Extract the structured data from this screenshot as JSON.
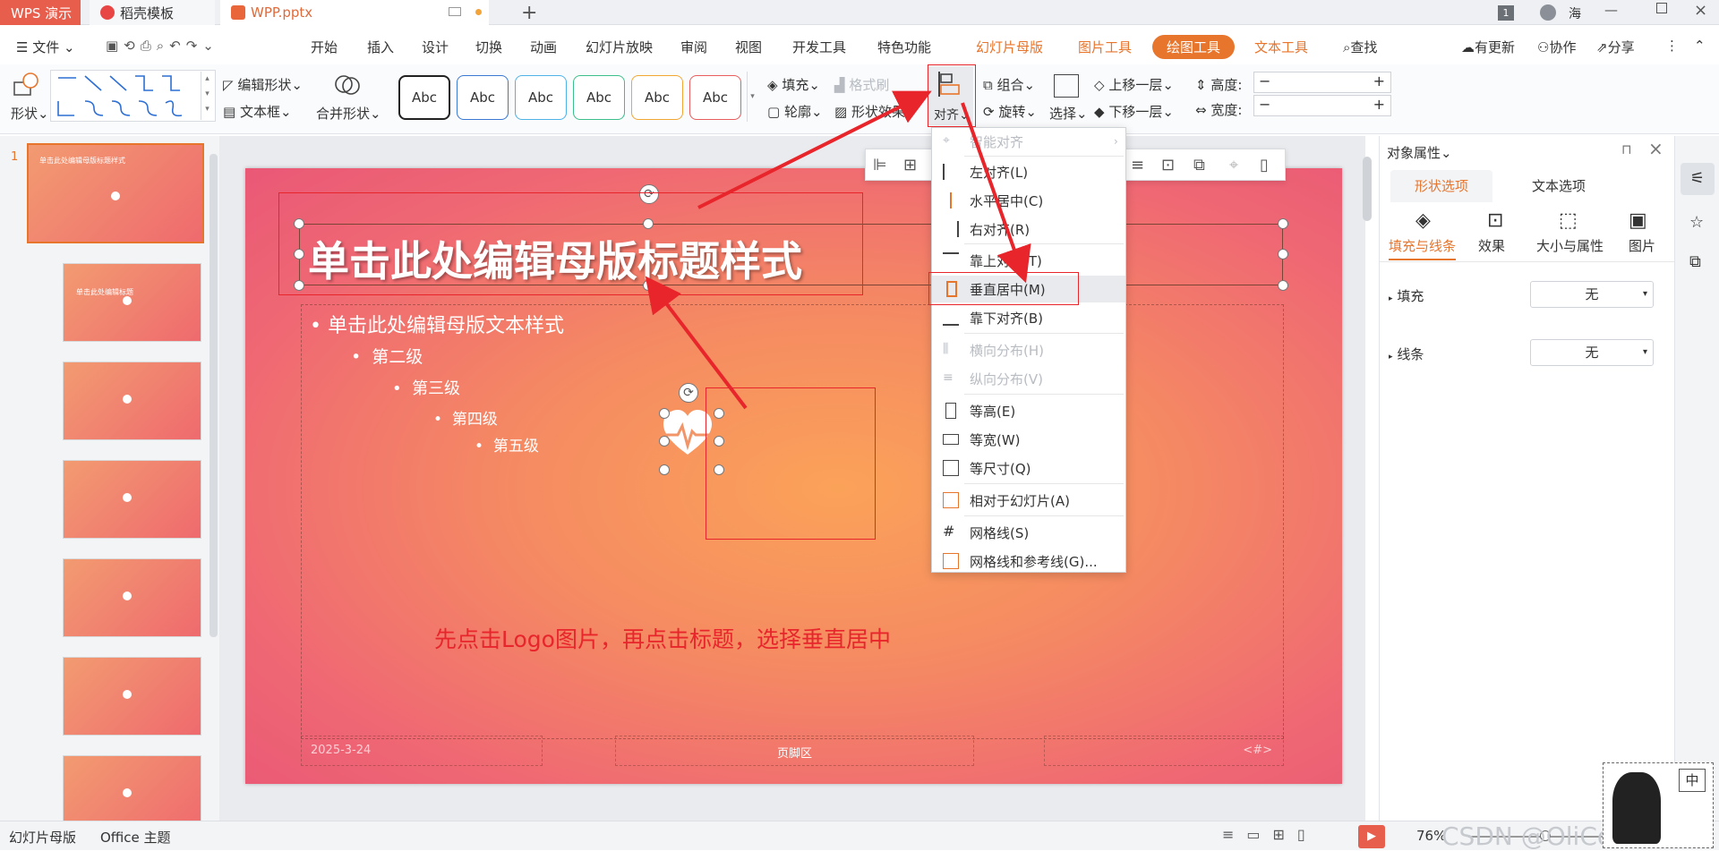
{
  "tabs": {
    "app": "WPS 演示",
    "template": "稻壳模板",
    "file": "WPP.pptx",
    "add": "+",
    "badge": "1",
    "user": "海"
  },
  "menu": {
    "file": "文件",
    "items": [
      "开始",
      "插入",
      "设计",
      "切换",
      "动画",
      "幻灯片放映",
      "审阅",
      "视图",
      "开发工具",
      "特色功能"
    ],
    "orange": [
      "幻灯片母版",
      "图片工具"
    ],
    "active": "绘图工具",
    "text_tool": "文本工具",
    "search": "查找",
    "update": "有更新",
    "coop": "协作",
    "share": "分享"
  },
  "ribbon": {
    "shape": "形状",
    "edit_shape": "编辑形状",
    "text_box": "文本框",
    "merge_shape": "合并形状",
    "style_label": "Abc",
    "fill": "填充",
    "format_brush": "格式刷",
    "outline": "轮廓",
    "shape_effect": "形状效果",
    "align": "对齐",
    "group": "组合",
    "rotate": "旋转",
    "select": "选择",
    "up_layer": "上移一层",
    "down_layer": "下移一层",
    "height_label": "高度:",
    "width_label": "宽度:",
    "minus": "−",
    "plus": "+"
  },
  "slide": {
    "title": "单击此处编辑母版标题样式",
    "l1": "单击此处编辑母版文本样式",
    "l2": "第二级",
    "l3": "第三级",
    "l4": "第四级",
    "l5": "第五级",
    "annotation": "先点击Logo图片，再点击标题，选择垂直居中",
    "date": "2025-3-24",
    "footer": "页脚区",
    "num": "<#>"
  },
  "thumbs": {
    "title_a": "单击此处编辑母版标题样式",
    "title_b": "单击此处编辑标题"
  },
  "dropdown": {
    "smart": "智能对齐",
    "left": "左对齐(L)",
    "hcenter": "水平居中(C)",
    "right": "右对齐(R)",
    "top": "靠上对齐(T)",
    "vcenter": "垂直居中(M)",
    "bottom": "靠下对齐(B)",
    "hdist": "横向分布(H)",
    "vdist": "纵向分布(V)",
    "same_h": "等高(E)",
    "same_w": "等宽(W)",
    "same_size": "等尺寸(Q)",
    "relative": "相对于幻灯片(A)",
    "grid": "网格线(S)",
    "grid_guides": "网格线和参考线(G)..."
  },
  "panel": {
    "title": "对象属性",
    "tab_shape": "形状选项",
    "tab_text": "文本选项",
    "fill_line": "填充与线条",
    "effect": "效果",
    "size": "大小与属性",
    "picture": "图片",
    "fill": "填充",
    "line": "线条",
    "fill_value": "无",
    "line_value": "无"
  },
  "status": {
    "slide_master": "幻灯片母版",
    "theme": "Office 主题",
    "zoom": "76%",
    "watermark": "CSDN @OliCorrect",
    "ime": "中"
  },
  "colors": {
    "accent": "#e8752c",
    "red": "#e8252b",
    "slide_text": "#ffffff"
  }
}
